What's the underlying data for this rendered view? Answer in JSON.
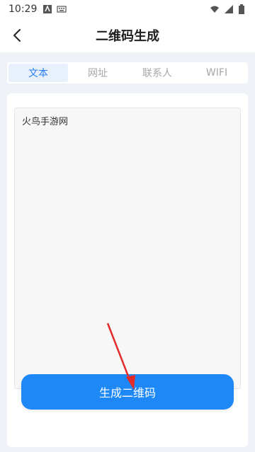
{
  "status": {
    "time": "10:29"
  },
  "header": {
    "title": "二维码生成"
  },
  "tabs": [
    {
      "label": "文本",
      "active": true
    },
    {
      "label": "网址",
      "active": false
    },
    {
      "label": "联系人",
      "active": false
    },
    {
      "label": "WIFI",
      "active": false
    }
  ],
  "input": {
    "value": "火鸟手游网"
  },
  "actions": {
    "generate_label": "生成二维码"
  },
  "colors": {
    "accent": "#1e88f7",
    "active_tab_bg": "#e7f0fb",
    "annotation": "#e32b2b"
  },
  "icons": [
    "back-arrow-icon",
    "a-notification-icon",
    "keyboard-icon",
    "wifi-icon",
    "signal-icon",
    "battery-icon"
  ]
}
